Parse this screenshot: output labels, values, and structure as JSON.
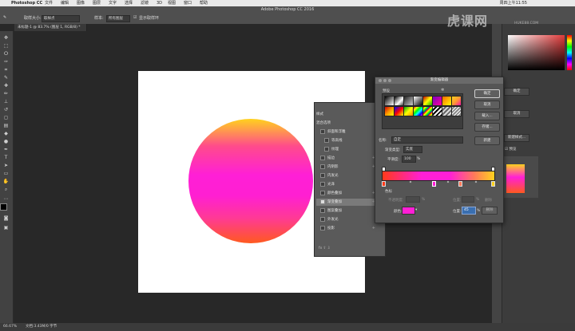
{
  "menubar": {
    "app_name": "Photoshop CC",
    "items": [
      "文件",
      "编辑",
      "图像",
      "图层",
      "文字",
      "选择",
      "滤镜",
      "3D",
      "视图",
      "窗口",
      "帮助"
    ],
    "clock": "周四上午11:55"
  },
  "window_title": "Adobe Photoshop CC 2016",
  "options": {
    "sample_size_label": "取样大小:",
    "sample_size_value": "取样点",
    "sample_label": "样本:",
    "sample_value": "所有图层",
    "show_ring_label": "显示取样环"
  },
  "doc_tab": "未标题-1 @ 83.7% (图层 1, RGB/8) *",
  "status": {
    "zoom": "66.67%",
    "doc_info": "文档:3.43M/0 字节"
  },
  "watermark": {
    "logo": "虎课网",
    "sub": "HUKE88.COM"
  },
  "layer_style": {
    "items": [
      {
        "label": "样式",
        "checkbox": false,
        "checked": false,
        "plus": false,
        "selected": false
      },
      {
        "label": "混合选项",
        "checkbox": false,
        "checked": false,
        "plus": false,
        "selected": false
      },
      {
        "label": "斜面和浮雕",
        "checkbox": true,
        "checked": false,
        "plus": false,
        "selected": false
      },
      {
        "label": "等高线",
        "checkbox": true,
        "checked": false,
        "plus": false,
        "selected": false
      },
      {
        "label": "纹理",
        "checkbox": true,
        "checked": false,
        "plus": false,
        "selected": false
      },
      {
        "label": "描边",
        "checkbox": true,
        "checked": false,
        "plus": true,
        "selected": false
      },
      {
        "label": "内阴影",
        "checkbox": true,
        "checked": false,
        "plus": true,
        "selected": false
      },
      {
        "label": "内发光",
        "checkbox": true,
        "checked": false,
        "plus": false,
        "selected": false
      },
      {
        "label": "光泽",
        "checkbox": true,
        "checked": false,
        "plus": false,
        "selected": false
      },
      {
        "label": "颜色叠加",
        "checkbox": true,
        "checked": false,
        "plus": true,
        "selected": false
      },
      {
        "label": "渐变叠加",
        "checkbox": true,
        "checked": true,
        "plus": true,
        "selected": true
      },
      {
        "label": "图案叠加",
        "checkbox": true,
        "checked": false,
        "plus": false,
        "selected": false
      },
      {
        "label": "外发光",
        "checkbox": true,
        "checked": false,
        "plus": false,
        "selected": false
      },
      {
        "label": "投影",
        "checkbox": true,
        "checked": false,
        "plus": true,
        "selected": false
      }
    ],
    "footer_icons": "fx ⇧ ⇩"
  },
  "gradient_editor": {
    "title": "渐变编辑器",
    "presets_label": "预设",
    "buttons": [
      "确定",
      "取消",
      "载入...",
      "存储..."
    ],
    "new_button": "新建",
    "name_label": "名称:",
    "name_value": "自定",
    "type_label": "渐变类型:",
    "type_value": "实底",
    "smooth_label": "平滑度:",
    "smooth_value": "100",
    "smooth_unit": "%",
    "color_stops_label": "色标",
    "opacity_label": "不透明度:",
    "opacity_unit": "%",
    "location_label": "位置:",
    "delete_label": "删除",
    "color_label": "颜色:",
    "position_label": "位置:",
    "position_value": "45",
    "position_unit": "%",
    "delete_button": "删除",
    "selected_color": "#ff1fd6"
  },
  "right_panel": {
    "buttons": [
      "确定",
      "取消",
      "新建样式...",
      "预览"
    ],
    "preview_label": "预览"
  }
}
